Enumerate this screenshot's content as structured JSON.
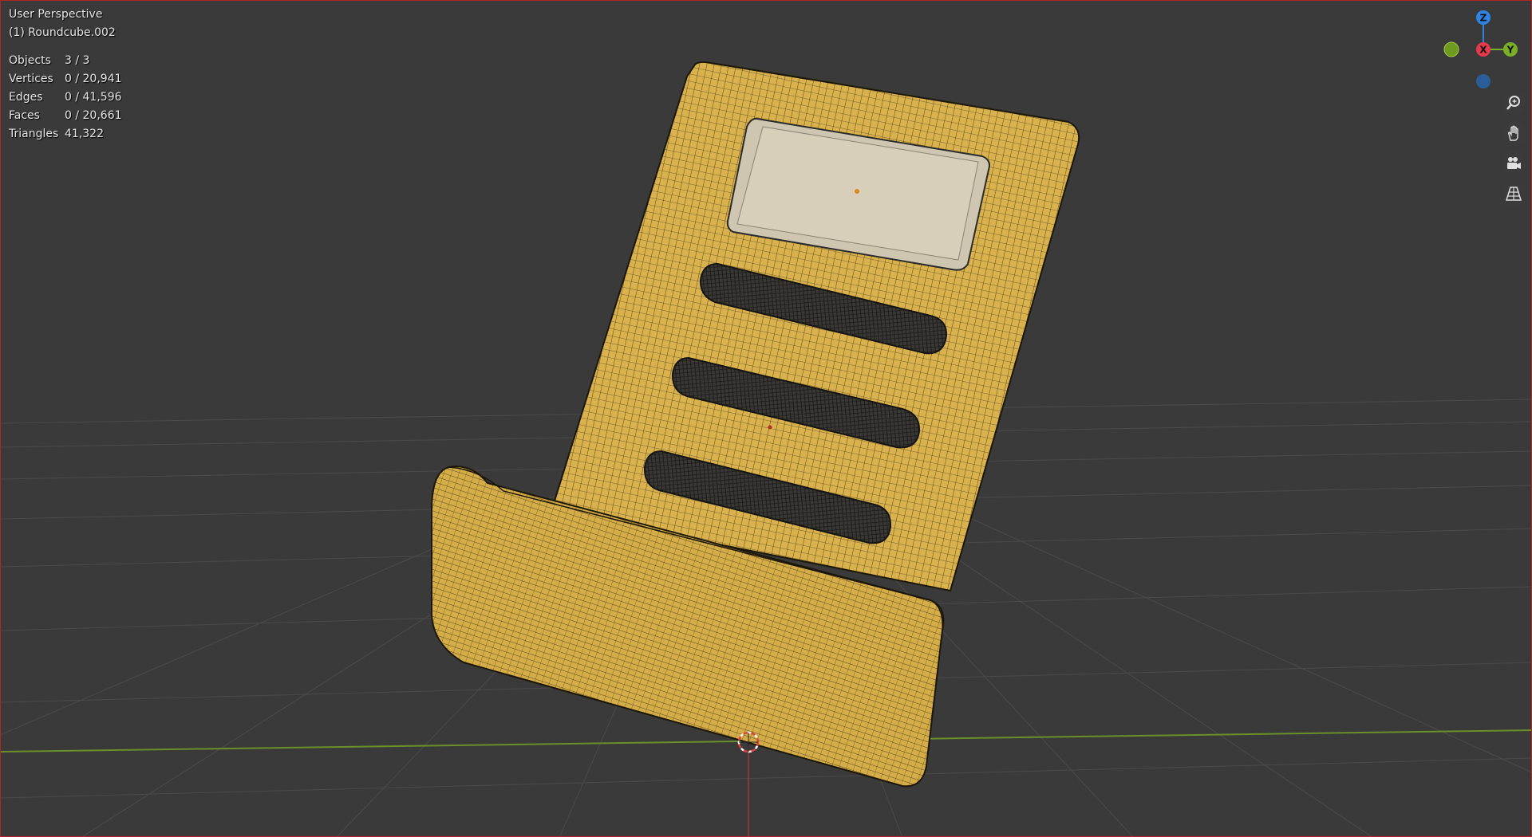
{
  "viewport": {
    "view_name": "User Perspective",
    "active_object": "(1) Roundcube.002",
    "stats": [
      {
        "label": "Objects",
        "value": "3 / 3"
      },
      {
        "label": "Vertices",
        "value": "0 / 20,941"
      },
      {
        "label": "Edges",
        "value": "0 / 41,596"
      },
      {
        "label": "Faces",
        "value": "0 / 20,661"
      },
      {
        "label": "Triangles",
        "value": "41,322"
      }
    ]
  },
  "gizmo": {
    "z_label": "Z",
    "x_label": "X",
    "y_label": "Y",
    "colors": {
      "x": "#e5394e",
      "y": "#7ab027",
      "z": "#2f84e3",
      "neg_y": "#6d9a1f",
      "neg_z": "#2a5e99"
    }
  },
  "nav_buttons": [
    {
      "icon": "zoom-icon"
    },
    {
      "icon": "hand-pan-icon"
    },
    {
      "icon": "camera-icon"
    },
    {
      "icon": "grid-perspective-icon"
    }
  ],
  "colors": {
    "background": "#3a3a3a",
    "grid": "#4c4c4c",
    "x_axis": "#a33a3a",
    "y_axis": "#6b8f2a",
    "model_fill": "#d9b24e",
    "wire": "#2c2410",
    "screen_fill": "#d8cfba"
  }
}
